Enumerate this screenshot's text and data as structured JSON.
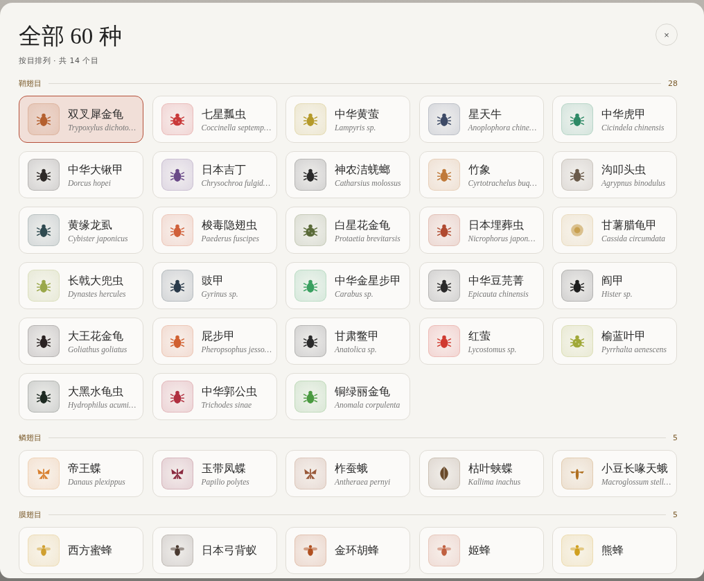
{
  "title": "全部 60 种",
  "subtitle": "按目排列 · 共 14 个目",
  "close": "×",
  "sections": [
    {
      "label": "鞘翅目",
      "count": "28",
      "items": [
        {
          "name": "双叉犀金龟",
          "latin": "Trypoxylus dichoto…",
          "kind": "beetle",
          "color": "#b5602f",
          "selected": true
        },
        {
          "name": "七星瓢虫",
          "latin": "Coccinella septemp…",
          "kind": "ladybug",
          "color": "#c93a3a",
          "selected": false
        },
        {
          "name": "中华黄萤",
          "latin": "Lampyris sp.",
          "kind": "beetle",
          "color": "#b59a2a",
          "selected": false
        },
        {
          "name": "星天牛",
          "latin": "Anoplophora chine…",
          "kind": "beetle",
          "color": "#3d4a66",
          "selected": false
        },
        {
          "name": "中华虎甲",
          "latin": "Cicindela chinensis",
          "kind": "beetle",
          "color": "#2e8a66",
          "selected": false
        },
        {
          "name": "中华大锹甲",
          "latin": "Dorcus hopei",
          "kind": "beetle",
          "color": "#2e2a28",
          "selected": false
        },
        {
          "name": "日本吉丁",
          "latin": "Chrysochroa fulgid…",
          "kind": "beetle",
          "color": "#6a4a88",
          "selected": false
        },
        {
          "name": "神农洁蜣螂",
          "latin": "Catharsius molossus",
          "kind": "beetle",
          "color": "#2a2a2a",
          "selected": false
        },
        {
          "name": "竹象",
          "latin": "Cyrtotrachelus buq…",
          "kind": "beetle",
          "color": "#c07a3a",
          "selected": false
        },
        {
          "name": "沟叩头虫",
          "latin": "Agrypnus binodulus",
          "kind": "beetle",
          "color": "#6a5a4a",
          "selected": false
        },
        {
          "name": "黄缘龙虱",
          "latin": "Cybister japonicus",
          "kind": "beetle",
          "color": "#2f4a50",
          "selected": false
        },
        {
          "name": "梭毒隐翅虫",
          "latin": "Paederus fuscipes",
          "kind": "beetle",
          "color": "#d0603a",
          "selected": false
        },
        {
          "name": "白星花金龟",
          "latin": "Protaetia brevitarsis",
          "kind": "ladybug",
          "color": "#5a6a38",
          "selected": false
        },
        {
          "name": "日本埋葬虫",
          "latin": "Nicrophorus japon…",
          "kind": "beetle",
          "color": "#b04a30",
          "selected": false
        },
        {
          "name": "甘薯腊龟甲",
          "latin": "Cassida circumdata",
          "kind": "disc",
          "color": "#c8a050",
          "selected": false
        },
        {
          "name": "长戟大兜虫",
          "latin": "Dynastes hercules",
          "kind": "beetle",
          "color": "#9aa84a",
          "selected": false
        },
        {
          "name": "豉甲",
          "latin": "Gyrinus sp.",
          "kind": "beetle",
          "color": "#2a3a4a",
          "selected": false
        },
        {
          "name": "中华金星步甲",
          "latin": "Carabus sp.",
          "kind": "beetle",
          "color": "#3aa060",
          "selected": false
        },
        {
          "name": "中华豆芫菁",
          "latin": "Epicauta chinensis",
          "kind": "beetle",
          "color": "#2a2a2a",
          "selected": false
        },
        {
          "name": "阎甲",
          "latin": "Hister sp.",
          "kind": "beetle",
          "color": "#1e1e1e",
          "selected": false
        },
        {
          "name": "大王花金龟",
          "latin": "Goliathus goliatus",
          "kind": "beetle",
          "color": "#2a2222",
          "selected": false
        },
        {
          "name": "屁步甲",
          "latin": "Pheropsophus jesso…",
          "kind": "beetle",
          "color": "#d06030",
          "selected": false
        },
        {
          "name": "甘肃鳖甲",
          "latin": "Anatolica sp.",
          "kind": "beetle",
          "color": "#2a2a2a",
          "selected": false
        },
        {
          "name": "红萤",
          "latin": "Lycostomus sp.",
          "kind": "beetle",
          "color": "#d03a30",
          "selected": false
        },
        {
          "name": "榆蓝叶甲",
          "latin": "Pyrrhalta aenescens",
          "kind": "ladybug",
          "color": "#a0a838",
          "selected": false
        },
        {
          "name": "大黑水龟虫",
          "latin": "Hydrophilus acumi…",
          "kind": "beetle",
          "color": "#1e2a22",
          "selected": false
        },
        {
          "name": "中华郭公虫",
          "latin": "Trichodes sinae",
          "kind": "beetle",
          "color": "#b03040",
          "selected": false
        },
        {
          "name": "铜绿丽金龟",
          "latin": "Anomala corpulenta",
          "kind": "beetle",
          "color": "#4a9a40",
          "selected": false
        }
      ]
    },
    {
      "label": "鳞翅目",
      "count": "5",
      "items": [
        {
          "name": "帝王蝶",
          "latin": "Danaus plexippus",
          "kind": "butterfly",
          "color": "#d88030",
          "selected": false
        },
        {
          "name": "玉带凤蝶",
          "latin": "Papilio polytes",
          "kind": "butterfly",
          "color": "#8a2a40",
          "selected": false
        },
        {
          "name": "柞蚕蛾",
          "latin": "Antheraea pernyi",
          "kind": "butterfly",
          "color": "#9a5a3a",
          "selected": false
        },
        {
          "name": "枯叶蛱蝶",
          "latin": "Kallima inachus",
          "kind": "leaf",
          "color": "#6a4a2a",
          "selected": false
        },
        {
          "name": "小豆长喙天蛾",
          "latin": "Macroglossum stell…",
          "kind": "hawkmoth",
          "color": "#b07020",
          "selected": false
        }
      ]
    },
    {
      "label": "膜翅目",
      "count": "5",
      "items": [
        {
          "name": "西方蜜蜂",
          "kind": "bee",
          "color": "#d0a030",
          "selected": false
        },
        {
          "name": "日本弓背蚁",
          "kind": "bee",
          "color": "#4a3a30",
          "selected": false
        },
        {
          "name": "金环胡蜂",
          "kind": "bee",
          "color": "#b05020",
          "selected": false
        },
        {
          "name": "姬蜂",
          "kind": "bee",
          "color": "#c06040",
          "selected": false
        },
        {
          "name": "熊蜂",
          "kind": "bee",
          "color": "#d0a020",
          "selected": false
        }
      ]
    }
  ]
}
